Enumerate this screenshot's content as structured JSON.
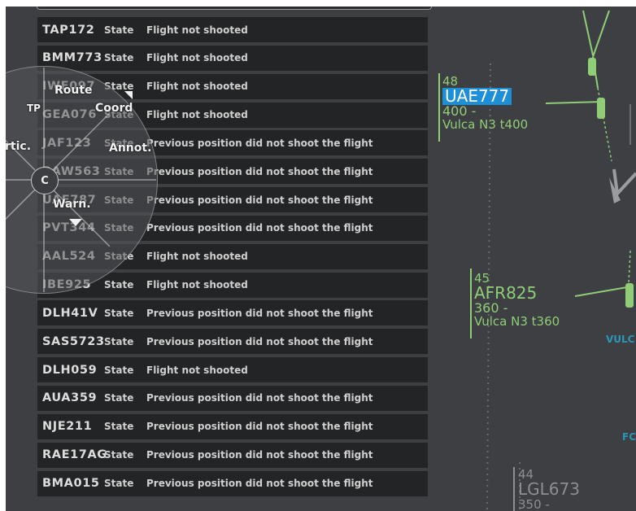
{
  "flights": [
    {
      "callsign": "TAP172",
      "label": "State",
      "status": "Flight not shooted"
    },
    {
      "callsign": "BMM773",
      "label": "State",
      "status": "Flight not shooted"
    },
    {
      "callsign": "IWE097",
      "label": "State",
      "status": "Flight not shooted"
    },
    {
      "callsign": "GEA076",
      "label": "State",
      "status": "Flight not shooted"
    },
    {
      "callsign": "JAF123",
      "label": "State",
      "status": "Previous position did not shoot the flight"
    },
    {
      "callsign": "BAW563",
      "label": "State",
      "status": "Previous position did not shoot the flight"
    },
    {
      "callsign": "UAE787",
      "label": "State",
      "status": "Previous position did not shoot the flight"
    },
    {
      "callsign": "PVT344",
      "label": "State",
      "status": "Previous position did not shoot the flight"
    },
    {
      "callsign": "AAL524",
      "label": "State",
      "status": "Flight not shooted"
    },
    {
      "callsign": "IBE925",
      "label": "State",
      "status": "Flight not shooted"
    },
    {
      "callsign": "DLH41V",
      "label": "State",
      "status": "Previous position did not shoot the flight"
    },
    {
      "callsign": "SAS5723",
      "label": "State",
      "status": "Previous position did not shoot the flight"
    },
    {
      "callsign": "DLH059",
      "label": "State",
      "status": "Flight not shooted"
    },
    {
      "callsign": "AUA359",
      "label": "State",
      "status": "Previous position did not shoot the flight"
    },
    {
      "callsign": "NJE211",
      "label": "State",
      "status": "Previous position did not shoot the flight"
    },
    {
      "callsign": "RAE17AG",
      "label": "State",
      "status": "Previous position did not shoot the flight"
    },
    {
      "callsign": "BMA015",
      "label": "State",
      "status": "Previous position did not shoot the flight"
    }
  ],
  "radial_menu": {
    "route": "Route",
    "coord": "Coord",
    "tp": "TP",
    "vertic": "rtic.",
    "center": "C",
    "annot": "Annot.",
    "warn": "Warn."
  },
  "radar": {
    "labels": [
      {
        "id": "uae777",
        "level": "48",
        "callsign": "UAE777",
        "cfl": "400 -",
        "route": "Vulca N3 t400",
        "selected": true
      },
      {
        "id": "afr825",
        "level": "45",
        "callsign": "AFR825",
        "cfl": "360 -",
        "route": "Vulca N3 t360",
        "selected": false
      }
    ],
    "grey_label": {
      "level": "44",
      "callsign": "LGL673",
      "cfl": "350 -"
    },
    "fixes": [
      "VULC",
      "FC"
    ]
  },
  "colors": {
    "background": "#3d3f42",
    "row": "#232426",
    "label_green": "#8fce77",
    "selected_blue": "#1c8fd6"
  }
}
